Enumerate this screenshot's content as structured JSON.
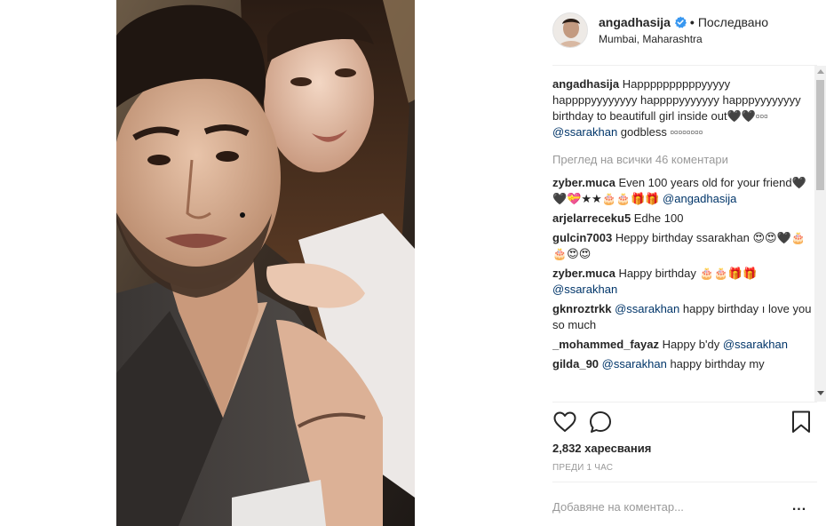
{
  "post": {
    "username": "angadhasija",
    "verified": true,
    "follow_state": "Последвано",
    "location": "Mumbai, Maharashtra",
    "caption": {
      "author": "angadhasija",
      "text": " Happppppppppyyyyy happppyyyyyyyy happppyyyyyyy happpyyyyyyyy birthday to beautifull girl inside out🖤🖤▫▫▫ ",
      "mention": "@ssarakhan",
      "text_after": " godbless ▫▫▫▫▫▫▫▫"
    },
    "view_all_label": "Преглед на всички 46 коментари",
    "comments": [
      {
        "author": "zyber.muca",
        "text": " Even 100 years old for your friend🖤🖤💝★★🎂🎂🎁🎁 ",
        "mention": "@angadhasija",
        "text_after": ""
      },
      {
        "author": "arjelarreceku5",
        "text": " Edhe 100",
        "mention": "",
        "text_after": ""
      },
      {
        "author": "gulcin7003",
        "text": " Heppy birthday ssarakhan 😍😍🖤🎂🎂😍😍",
        "mention": "",
        "text_after": ""
      },
      {
        "author": "zyber.muca",
        "text": " Happy birthday 🎂🎂🎁🎁 ",
        "mention": "@ssarakhan",
        "text_after": ""
      },
      {
        "author": "gknroztrkk",
        "text": " ",
        "mention": "@ssarakhan",
        "text_after": " happy birthday ı love you so much"
      },
      {
        "author": "_mohammed_fayaz",
        "text": " Happy b'dy ",
        "mention": "@ssarakhan",
        "text_after": ""
      },
      {
        "author": "gilda_90",
        "text": " ",
        "mention": "@ssarakhan",
        "text_after": " happy birthday my"
      }
    ],
    "likes_label": "2,832 харесвания",
    "time_label": "ПРЕДИ 1 ЧАС",
    "add_comment_placeholder": "Добавяне на коментар...",
    "more_label": "..."
  },
  "icons": {
    "like": "heart-outline-icon",
    "comment": "speech-bubble-icon",
    "save": "bookmark-icon",
    "verified": "verified-badge-icon"
  },
  "colors": {
    "text": "#262626",
    "secondary": "#999999",
    "mention": "#003569",
    "verified": "#3897f0",
    "divider": "#efefef"
  }
}
